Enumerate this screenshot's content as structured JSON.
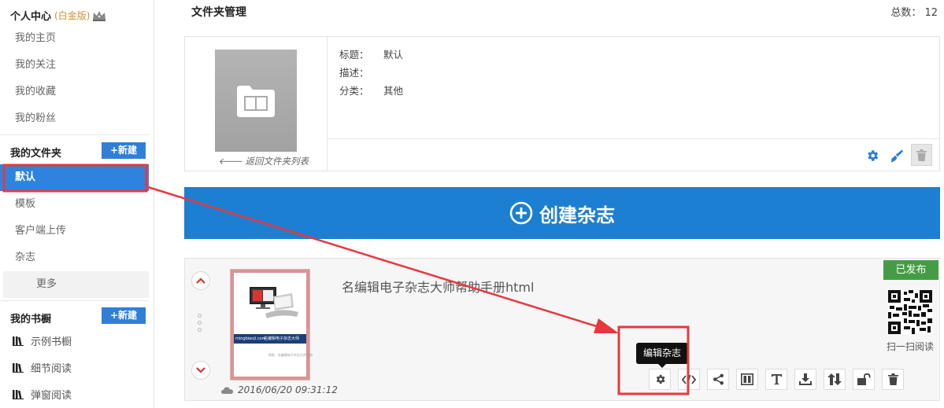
{
  "sidebar": {
    "user_center": "个人中心",
    "platinum": "(白金版)",
    "nav": [
      "我的主页",
      "我的关注",
      "我的收藏",
      "我的粉丝"
    ],
    "folders_title": "我的文件夹",
    "new_label": "+新建",
    "folders": [
      "默认",
      "模板",
      "客户端上传",
      "杂志"
    ],
    "more": "更多",
    "bookshelf_title": "我的书橱",
    "shelves": [
      "示例书橱",
      "细节阅读",
      "弹窗阅读"
    ]
  },
  "main": {
    "page_title": "文件夹管理",
    "total": "总数： 12",
    "folder": {
      "back_link": "返回文件夹列表",
      "title_label": "标题：",
      "title_value": "默认",
      "desc_label": "描述：",
      "desc_value": "",
      "category_label": "分类：",
      "category_value": "其他"
    },
    "create_button": "创建杂志",
    "magazine": {
      "title": "名编辑电子杂志大师帮助手册html",
      "date": "2016/06/20 09:31:12",
      "status": "已发布",
      "qr_label": "扫一扫阅读",
      "tooltip": "编辑杂志",
      "cover_band_left": "mingbianji.com",
      "cover_band_right": "名编辑电子杂志大师",
      "cover_sub": "帮助 · 名编辑电子杂志大师手册"
    }
  },
  "colors": {
    "accent": "#2e83de",
    "create": "#1d7fd1",
    "published": "#449d44",
    "annotation": "#e8383d"
  }
}
